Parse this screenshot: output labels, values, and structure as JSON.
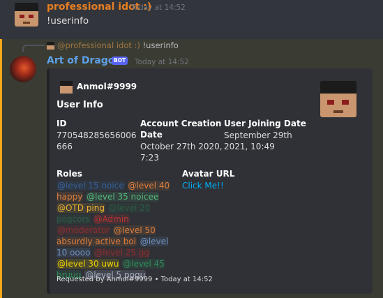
{
  "message1": {
    "author": "professional idot :)",
    "author_color": "#e67e22",
    "timestamp": "Today at 14:52",
    "content": "!userinfo"
  },
  "message2": {
    "reply": {
      "mention": "@professional idot :)",
      "content": "!userinfo"
    },
    "author": "Art of Dragons",
    "author_color": "#5da0e6",
    "bot_badge": "BOT",
    "timestamp": "Today at 14:52",
    "embed": {
      "author": "Anmol#9999",
      "title": "User Info",
      "fields": {
        "id": {
          "name": "ID",
          "value_line1": "770548285656006",
          "value_line2": "666"
        },
        "account_creation": {
          "name_line1": "Account Creation",
          "name_line2": "Date",
          "value_line1": "October 27th 2020,",
          "value_line2": "7:23"
        },
        "joining": {
          "name": "User Joining Date",
          "value_line1": "September 29th",
          "value_line2": "2021, 10:49"
        },
        "roles": {
          "name": "Roles"
        },
        "avatar": {
          "name": "Avatar URL",
          "value": "Click Me!!"
        }
      },
      "roles": [
        {
          "label": "@level 15 noice",
          "style": "r-blue-dark"
        },
        {
          "label": "@level 40 happy",
          "style": "r-orange"
        },
        {
          "label": "@level 35 noicee",
          "style": "r-green"
        },
        {
          "label": "@OTD ping",
          "style": "r-yellow"
        },
        {
          "label": "@level 20 pogcors",
          "style": "r-greendark"
        },
        {
          "label": "@Admin",
          "style": "r-red"
        },
        {
          "label": "@moderator",
          "style": "r-darkred"
        },
        {
          "label": "@level 50 absurdly active boi",
          "style": "r-orange"
        },
        {
          "label": "@level 10 oooo",
          "style": "r-blue"
        },
        {
          "label": "@level 25 gg",
          "style": "r-darkred"
        },
        {
          "label": "@level 30 uwu",
          "style": "r-brightyellow"
        },
        {
          "label": "@level 45 bruuu",
          "style": "r-teal"
        },
        {
          "label": "@level 5 pogu",
          "style": "r-gray"
        }
      ],
      "footer": "Requested by Anmol#9999 • Today at 14:52"
    }
  }
}
